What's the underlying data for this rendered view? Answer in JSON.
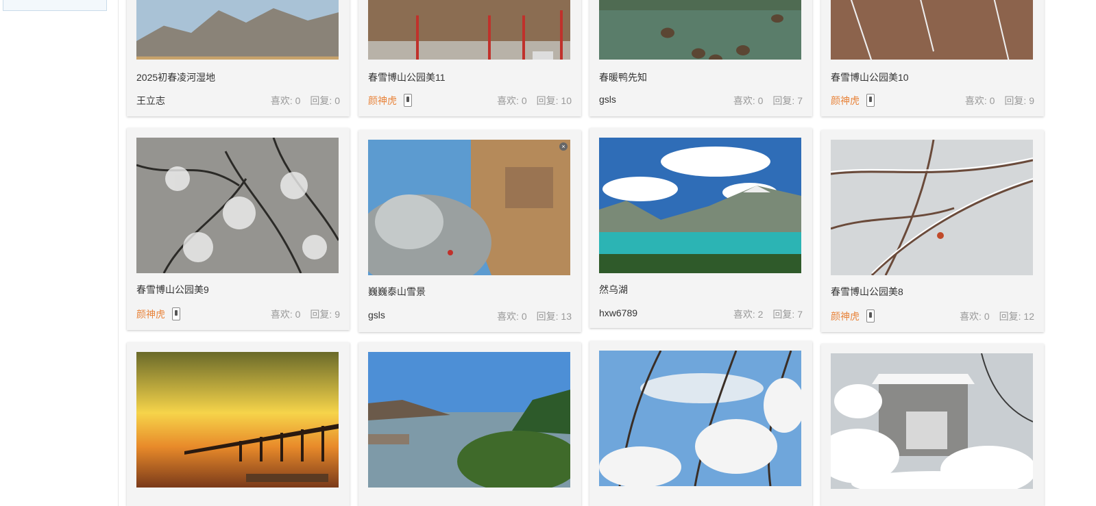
{
  "cards": [
    {
      "title": "2025初春凌河湿地",
      "author": "王立志",
      "vip": false,
      "likes_label": "喜欢: ",
      "likes": "0",
      "replies_label": "回复: ",
      "replies": "0",
      "image": "wetland-lake-photo"
    },
    {
      "title": "春雪博山公园美11",
      "author": "颜神虎",
      "vip": true,
      "likes_label": "喜欢: ",
      "likes": "0",
      "replies_label": "回复: ",
      "replies": "10",
      "image": "snowy-park-photo"
    },
    {
      "title": "春暖鸭先知",
      "author": "gsls",
      "vip": false,
      "likes_label": "喜欢: ",
      "likes": "0",
      "replies_label": "回复: ",
      "replies": "7",
      "image": "ducks-pond-photo"
    },
    {
      "title": "春雪博山公园美10",
      "author": "颜神虎",
      "vip": true,
      "likes_label": "喜欢: ",
      "likes": "0",
      "replies_label": "回复: ",
      "replies": "9",
      "image": "snowy-shrubs-photo"
    },
    {
      "title": "春雪博山公园美9",
      "author": "颜神虎",
      "vip": true,
      "likes_label": "喜欢: ",
      "likes": "0",
      "replies_label": "回复: ",
      "replies": "9",
      "image": "snowy-trees-photo"
    },
    {
      "title": "巍巍泰山雪景",
      "author": "gsls",
      "vip": false,
      "likes_label": "喜欢: ",
      "likes": "0",
      "replies_label": "回复: ",
      "replies": "13",
      "image": "mount-tai-cliff-photo"
    },
    {
      "title": "然乌湖",
      "author": "hxw6789",
      "vip": false,
      "likes_label": "喜欢: ",
      "likes": "2",
      "replies_label": "回复: ",
      "replies": "7",
      "image": "mountain-lake-photo"
    },
    {
      "title": "春雪博山公园美8",
      "author": "颜神虎",
      "vip": true,
      "likes_label": "喜欢: ",
      "likes": "0",
      "replies_label": "回复: ",
      "replies": "12",
      "image": "snowy-branches-photo"
    },
    {
      "title": "",
      "author": "",
      "vip": false,
      "likes_label": "",
      "likes": "",
      "replies_label": "",
      "replies": "",
      "image": "sunset-bridge-photo"
    },
    {
      "title": "",
      "author": "",
      "vip": false,
      "likes_label": "",
      "likes": "",
      "replies_label": "",
      "replies": "",
      "image": "coastal-bay-photo"
    },
    {
      "title": "",
      "author": "",
      "vip": false,
      "likes_label": "",
      "likes": "",
      "replies_label": "",
      "replies": "",
      "image": "snow-forest-sky-photo"
    },
    {
      "title": "",
      "author": "",
      "vip": false,
      "likes_label": "",
      "likes": "",
      "replies_label": "",
      "replies": "",
      "image": "snowy-house-photo"
    }
  ],
  "colors": {
    "vip_author": "#e8833a",
    "stats": "#999999",
    "card_bg": "#f4f4f4"
  }
}
